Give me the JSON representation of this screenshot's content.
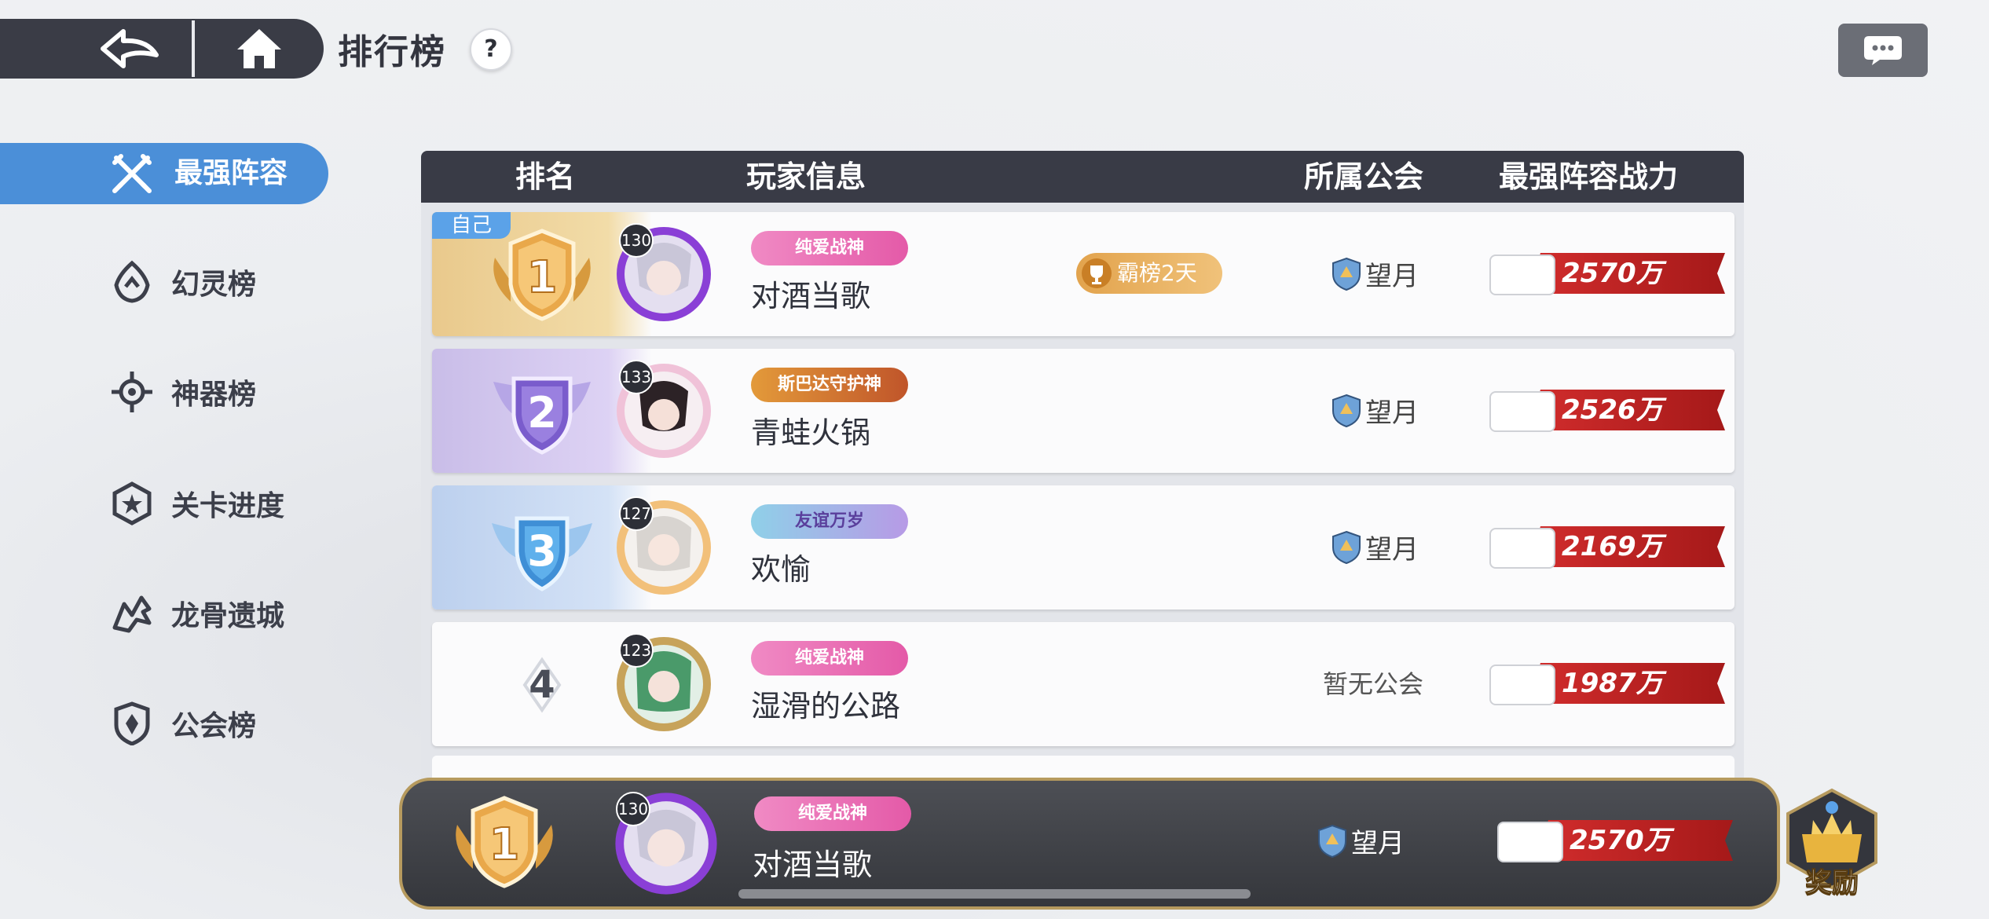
{
  "header": {
    "title": "排行榜",
    "help_label": "?"
  },
  "sidebar": {
    "active": {
      "label": "最强阵容",
      "icon": "crossed-swords-icon"
    },
    "items": [
      {
        "label": "幻灵榜",
        "icon": "spirit-icon"
      },
      {
        "label": "神器榜",
        "icon": "artifact-icon"
      },
      {
        "label": "关卡进度",
        "icon": "stage-icon"
      },
      {
        "label": "龙骨遗城",
        "icon": "dragon-icon"
      },
      {
        "label": "公会榜",
        "icon": "guild-shield-icon"
      }
    ]
  },
  "table": {
    "headers": {
      "rank": "排名",
      "player": "玩家信息",
      "guild": "所属公会",
      "power": "最强阵容战力"
    },
    "rows": [
      {
        "rank": "1",
        "level": "130",
        "title": "纯爱战神",
        "name": "对酒当歌",
        "guild": "望月",
        "power": "2570万",
        "self_tag": "自己",
        "dominance": "霸榜2天"
      },
      {
        "rank": "2",
        "level": "133",
        "title": "斯巴达守护神",
        "name": "青蛙火锅",
        "guild": "望月",
        "power": "2526万"
      },
      {
        "rank": "3",
        "level": "127",
        "title": "友谊万岁",
        "name": "欢愉",
        "guild": "望月",
        "power": "2169万"
      },
      {
        "rank": "4",
        "level": "123",
        "title": "纯爱战神",
        "name": "湿滑的公路",
        "guild": "暂无公会",
        "power": "1987万"
      }
    ]
  },
  "self_bar": {
    "rank": "1",
    "level": "130",
    "title": "纯爱战神",
    "name": "对酒当歌",
    "guild": "望月",
    "power": "2570万"
  },
  "reward": {
    "label": "奖励"
  },
  "colors": {
    "accent": "#4b8fd8",
    "header_bg": "#393b46",
    "power_red": "#c22525",
    "gold": "#e2a34d"
  }
}
